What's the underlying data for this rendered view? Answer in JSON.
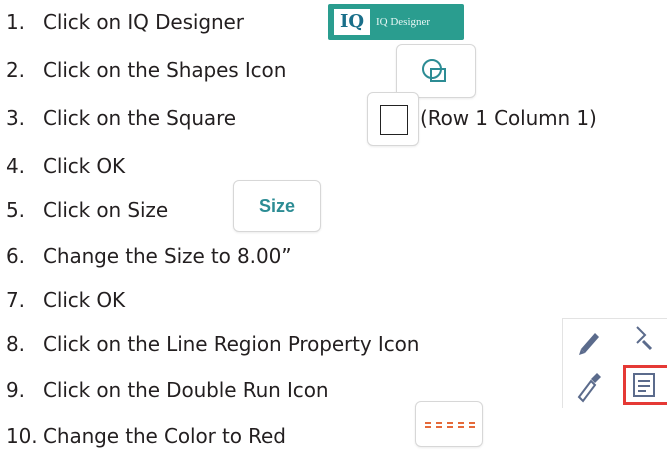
{
  "steps": [
    {
      "number": "1.",
      "text": "Click on IQ Designer"
    },
    {
      "number": "2.",
      "text": "Click on the Shapes Icon"
    },
    {
      "number": "3.",
      "text": "Click on the Square",
      "extra": "(Row 1  Column 1)"
    },
    {
      "number": "4.",
      "text": "Click OK"
    },
    {
      "number": "5.",
      "text": "Click on Size"
    },
    {
      "number": "6.",
      "text": "Change the Size to 8.00”"
    },
    {
      "number": "7.",
      "text": "Click OK"
    },
    {
      "number": "8.",
      "text": "Click on the Line Region Property Icon"
    },
    {
      "number": "9.",
      "text": "Click on the Double Run Icon"
    },
    {
      "number": "10.",
      "text": "Change the Color to Red"
    }
  ],
  "inline_images": {
    "iq_designer": {
      "logo_text": "IQ",
      "label": "IQ Designer",
      "icon": "iq-designer-logo",
      "color": "#2a9d8f"
    },
    "shapes": {
      "icon": "shapes-icon",
      "color": "#2c8c94"
    },
    "square": {
      "icon": "square-shape-icon"
    },
    "size": {
      "label": "Size",
      "color": "#2c8c94"
    },
    "line_region_property": {
      "icon": "line-region-property-icon",
      "highlight_color": "#e53935"
    },
    "double_run": {
      "icon": "double-run-icon",
      "color": "#e56a3a"
    }
  }
}
